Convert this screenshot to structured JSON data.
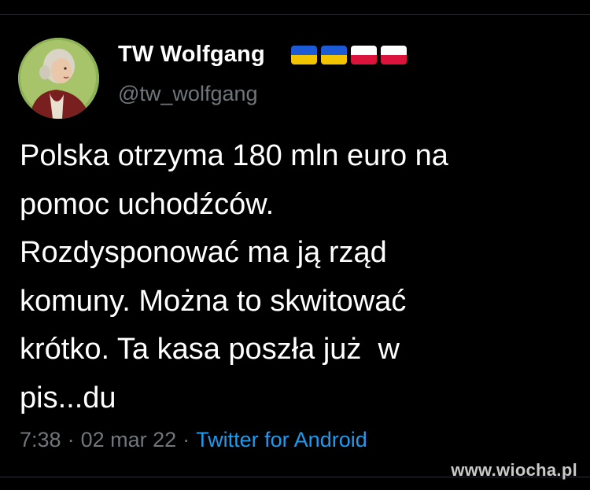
{
  "author": {
    "display_name": "TW Wolfgang",
    "handle": "@tw_wolfgang",
    "avatar_icon": "mozart-portrait-avatar",
    "flags": [
      {
        "icon": "ukraine-flag-icon",
        "top": "#1d5bd6",
        "bottom": "#f2c400"
      },
      {
        "icon": "ukraine-flag-icon",
        "top": "#1d5bd6",
        "bottom": "#f2c400"
      },
      {
        "icon": "poland-flag-icon",
        "top": "#ffffff",
        "bottom": "#dc143c"
      },
      {
        "icon": "poland-flag-icon",
        "top": "#ffffff",
        "bottom": "#dc143c"
      }
    ]
  },
  "tweet": {
    "lines": [
      "Polska otrzyma 180 mln euro na",
      "pomoc uchodźców.",
      "Rozdysponować ma ją rząd",
      "komuny. Można to skwitować",
      "krótko. Ta kasa poszła już  w",
      "pis...du"
    ]
  },
  "meta": {
    "time": "7:38",
    "separator": "·",
    "date": "02 mar 22",
    "source": "Twitter for Android"
  },
  "watermark": "www.wiocha.pl",
  "colors": {
    "background": "#000000",
    "text": "#ffffff",
    "secondary": "#71767b",
    "link": "#1d9bf0"
  }
}
